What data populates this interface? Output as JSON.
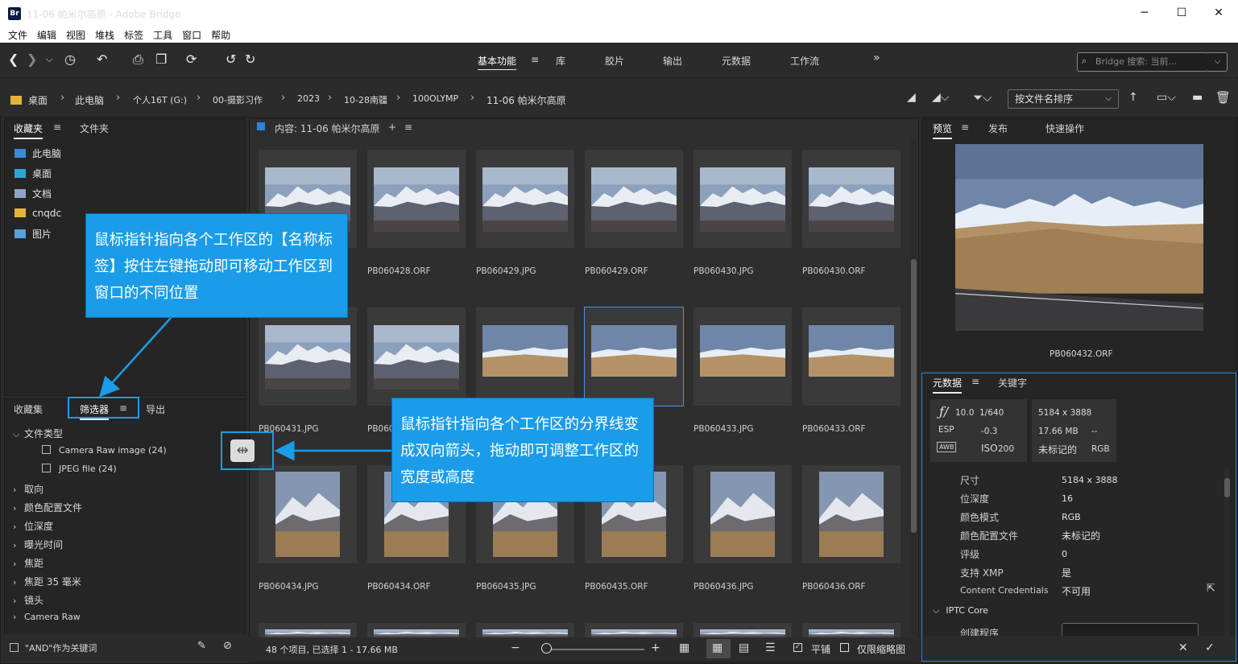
{
  "window": {
    "title": "11-06 帕米尔高原 - Adobe Bridge",
    "app_icon": "Br"
  },
  "menu": [
    "文件",
    "编辑",
    "视图",
    "堆栈",
    "标签",
    "工具",
    "窗口",
    "帮助"
  ],
  "workspaces": [
    "基本功能",
    "库",
    "胶片",
    "输出",
    "元数据",
    "工作流"
  ],
  "search": {
    "placeholder": "Bridge 搜索: 当前..."
  },
  "breadcrumb": [
    "桌面",
    "此电脑",
    "个人16T (G:)",
    "00-摄影习作",
    "2023",
    "10-28南疆",
    "100OLYMP",
    "11-06 帕米尔高原"
  ],
  "sort": {
    "label": "按文件名排序"
  },
  "left_top": {
    "tabs": [
      "收藏夹",
      "文件夹"
    ],
    "items": [
      "此电脑",
      "桌面",
      "文档",
      "cnqdc",
      "图片"
    ]
  },
  "left_bottom": {
    "tabs": [
      "收藏集",
      "筛选器",
      "导出"
    ],
    "filters": {
      "file_type": "文件类型",
      "types": [
        "Camera Raw image (24)",
        "JPEG file (24)"
      ],
      "groups": [
        "取向",
        "颜色配置文件",
        "位深度",
        "曝光时间",
        "焦距",
        "焦距 35 毫米",
        "镜头",
        "Camera Raw"
      ]
    },
    "and_keywords": "\"AND\"作为关键词"
  },
  "content": {
    "title": "内容: 11-06 帕米尔高原",
    "labels": [
      "",
      "PB060428.ORF",
      "PB060429.JPG",
      "PB060429.ORF",
      "PB060430.JPG",
      "PB060430.ORF",
      "PB060431.JPG",
      "PB060",
      "",
      "",
      "PB060433.JPG",
      "PB060433.ORF",
      "PB060434.JPG",
      "PB060434.ORF",
      "PB060435.JPG",
      "PB060435.ORF",
      "PB060436.JPG",
      "PB060436.ORF"
    ]
  },
  "status": {
    "text": "48 个项目, 已选择 1 - 17.66 MB",
    "tile": "平铺",
    "thumbs_only": "仅限缩略图"
  },
  "preview": {
    "tabs": [
      "预览",
      "发布",
      "快速操作"
    ],
    "filename": "PB060432.ORF"
  },
  "metadata": {
    "tabs": [
      "元数据",
      "关键字"
    ],
    "info": {
      "f": "10.0",
      "shutter": "1/640",
      "dims": "5184 x 3888",
      "esp": "ESP",
      "ev": "-0.3",
      "size": "17.66 MB",
      "dash": "--",
      "awb": "AWB",
      "iso_label": "ISO",
      "iso": "200",
      "untagged": "未标记的",
      "rgb": "RGB"
    },
    "rows": [
      {
        "k": "尺寸",
        "v": "5184 x 3888"
      },
      {
        "k": "位深度",
        "v": "16"
      },
      {
        "k": "颜色模式",
        "v": "RGB"
      },
      {
        "k": "颜色配置文件",
        "v": "未标记的"
      },
      {
        "k": "评级",
        "v": "0"
      },
      {
        "k": "支持 XMP",
        "v": "是"
      },
      {
        "k": "Content Credentials",
        "v": "不可用"
      }
    ],
    "iptc": "IPTC Core",
    "creator": "创建程序"
  },
  "callouts": {
    "top": "鼠标指针指向各个工作区的【名称标签】按住左键拖动即可移动工作区到窗口的不同位置",
    "mid": "鼠标指针指向各个工作区的分界线变成双向箭头，拖动即可调整工作区的宽度或高度"
  },
  "colors": {
    "accent": "#1b9ce8",
    "selection": "#4b8fe8",
    "panel": "#252525"
  }
}
